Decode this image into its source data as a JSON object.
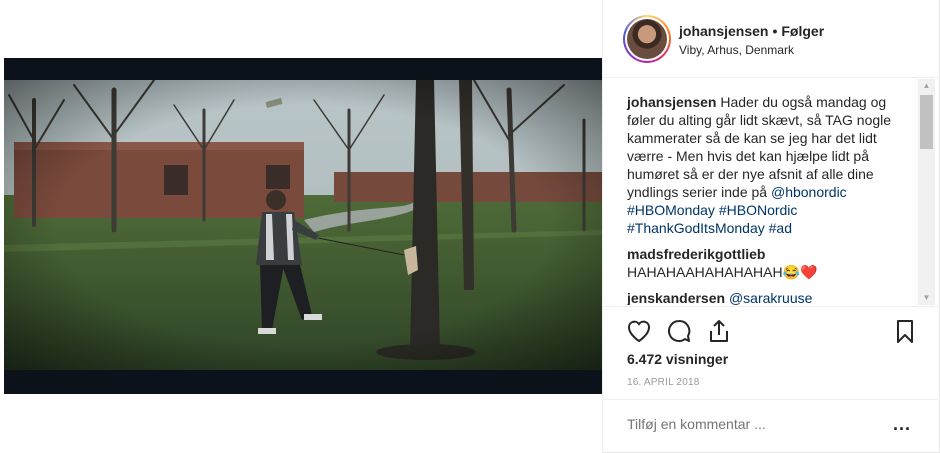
{
  "header": {
    "username": "johansjensen",
    "separator": "•",
    "follow_label": "Følger",
    "location": "Viby, Arhus, Denmark"
  },
  "caption": {
    "username": "johansjensen",
    "text": "Hader du også mandag og føler du alting går lidt skævt, så TAG nogle kammerater så de kan se jeg har det lidt værre - Men hvis det kan hjælpe lidt på humøret så er der nye afsnit af alle dine yndlings serier inde på",
    "mention": "@hbonordic",
    "hashtags": [
      "#HBOMonday",
      "#HBONordic",
      "#ThankGodItsMonday",
      "#ad"
    ]
  },
  "comments": [
    {
      "username": "madsfrederikgottlieb",
      "text": "HAHAHAAHAHAHAHAH😂❤️"
    },
    {
      "username": "jenskandersen",
      "text": "@sarakruuse"
    }
  ],
  "stats": {
    "views": "6.472 visninger",
    "date": "16. APRIL 2018"
  },
  "add_comment": {
    "placeholder": "Tilføj en kommentar ...",
    "more_label": "..."
  },
  "icons": [
    "heart-icon",
    "comment-icon",
    "share-icon",
    "bookmark-icon",
    "more-icon"
  ]
}
